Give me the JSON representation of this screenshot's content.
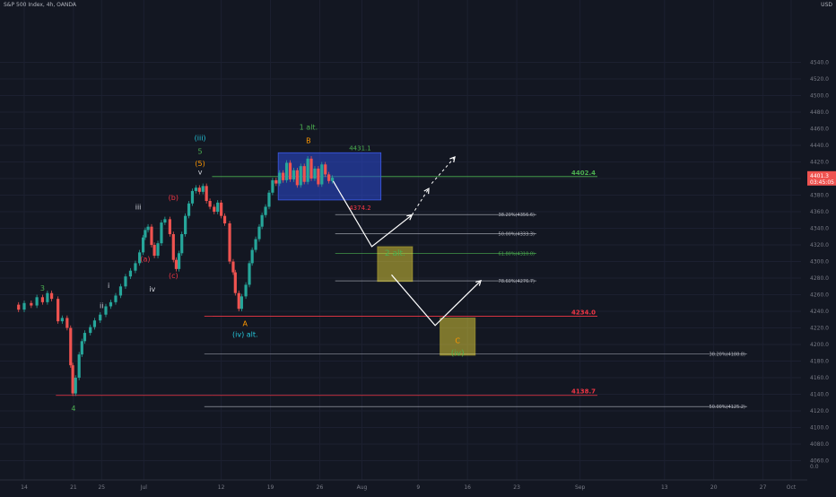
{
  "header": {
    "title": "S&P 500 Index, 4h, OANDA",
    "unit": "USD"
  },
  "chart_data": {
    "type": "candlestick",
    "title": "S&P 500 Index, 4h, OANDA",
    "ylim": [
      4053,
      4558
    ],
    "y_ticks": [
      4060.0,
      4080.0,
      4100.0,
      4120.0,
      4140.0,
      4160.0,
      4180.0,
      4200.0,
      4220.0,
      4240.0,
      4260.0,
      4280.0,
      4300.0,
      4320.0,
      4340.0,
      4360.0,
      4380.0,
      4400.0,
      4420.0,
      4440.0,
      4460.0,
      4480.0,
      4500.0,
      4520.0,
      4540.0
    ],
    "y_zero_label": "0.0",
    "x_ticks": [
      {
        "label": "14",
        "day": 0
      },
      {
        "label": "21",
        "day": 7
      },
      {
        "label": "25",
        "day": 11
      },
      {
        "label": "Jul",
        "day": 17
      },
      {
        "label": "12",
        "day": 28
      },
      {
        "label": "19",
        "day": 35
      },
      {
        "label": "26",
        "day": 42
      },
      {
        "label": "Aug",
        "day": 48
      },
      {
        "label": "9",
        "day": 56
      },
      {
        "label": "16",
        "day": 63
      },
      {
        "label": "23",
        "day": 70
      },
      {
        "label": "Sep",
        "day": 79
      },
      {
        "label": "13",
        "day": 91
      },
      {
        "label": "20",
        "day": 98
      },
      {
        "label": "27",
        "day": 105
      },
      {
        "label": "Oct",
        "day": 109
      }
    ],
    "price_path": [
      {
        "day": -1.6,
        "price": 4248
      },
      {
        "day": -0.8,
        "price": 4242
      },
      {
        "day": 0,
        "price": 4250
      },
      {
        "day": 1,
        "price": 4247
      },
      {
        "day": 1.8,
        "price": 4257
      },
      {
        "day": 2.6,
        "price": 4251
      },
      {
        "day": 3.3,
        "price": 4262
      },
      {
        "day": 3.9,
        "price": 4255
      },
      {
        "day": 4.8,
        "price": 4228
      },
      {
        "day": 5.4,
        "price": 4232
      },
      {
        "day": 6.1,
        "price": 4220
      },
      {
        "day": 6.6,
        "price": 4175
      },
      {
        "day": 6.9,
        "price": 4141
      },
      {
        "day": 7.3,
        "price": 4160
      },
      {
        "day": 7.8,
        "price": 4188
      },
      {
        "day": 8.2,
        "price": 4204
      },
      {
        "day": 8.6,
        "price": 4214
      },
      {
        "day": 9.4,
        "price": 4221
      },
      {
        "day": 10,
        "price": 4229
      },
      {
        "day": 10.8,
        "price": 4236
      },
      {
        "day": 11.6,
        "price": 4246
      },
      {
        "day": 12.3,
        "price": 4251
      },
      {
        "day": 13,
        "price": 4259
      },
      {
        "day": 13.7,
        "price": 4270
      },
      {
        "day": 14.4,
        "price": 4282
      },
      {
        "day": 15.1,
        "price": 4289
      },
      {
        "day": 15.8,
        "price": 4298
      },
      {
        "day": 16.4,
        "price": 4311
      },
      {
        "day": 16.9,
        "price": 4329
      },
      {
        "day": 17.2,
        "price": 4338
      },
      {
        "day": 17.6,
        "price": 4342
      },
      {
        "day": 18.1,
        "price": 4320
      },
      {
        "day": 18.5,
        "price": 4307
      },
      {
        "day": 19,
        "price": 4322
      },
      {
        "day": 19.5,
        "price": 4347
      },
      {
        "day": 20,
        "price": 4351
      },
      {
        "day": 20.7,
        "price": 4333
      },
      {
        "day": 21.2,
        "price": 4302
      },
      {
        "day": 21.6,
        "price": 4291
      },
      {
        "day": 22,
        "price": 4310
      },
      {
        "day": 22.4,
        "price": 4333
      },
      {
        "day": 22.9,
        "price": 4355
      },
      {
        "day": 23.4,
        "price": 4370
      },
      {
        "day": 23.9,
        "price": 4385
      },
      {
        "day": 24.4,
        "price": 4389
      },
      {
        "day": 24.9,
        "price": 4384
      },
      {
        "day": 25.4,
        "price": 4391
      },
      {
        "day": 25.9,
        "price": 4373
      },
      {
        "day": 26.4,
        "price": 4366
      },
      {
        "day": 27,
        "price": 4360
      },
      {
        "day": 27.5,
        "price": 4371
      },
      {
        "day": 28,
        "price": 4355
      },
      {
        "day": 28.5,
        "price": 4346
      },
      {
        "day": 29.2,
        "price": 4300
      },
      {
        "day": 29.7,
        "price": 4287
      },
      {
        "day": 30,
        "price": 4262
      },
      {
        "day": 30.5,
        "price": 4243
      },
      {
        "day": 30.9,
        "price": 4258
      },
      {
        "day": 31.5,
        "price": 4272
      },
      {
        "day": 32,
        "price": 4298
      },
      {
        "day": 32.4,
        "price": 4314
      },
      {
        "day": 32.9,
        "price": 4327
      },
      {
        "day": 33.4,
        "price": 4342
      },
      {
        "day": 33.8,
        "price": 4356
      },
      {
        "day": 34.3,
        "price": 4366
      },
      {
        "day": 34.8,
        "price": 4383
      },
      {
        "day": 35.3,
        "price": 4398
      },
      {
        "day": 35.8,
        "price": 4394
      },
      {
        "day": 36.3,
        "price": 4407
      },
      {
        "day": 36.8,
        "price": 4398
      },
      {
        "day": 37.3,
        "price": 4419
      },
      {
        "day": 37.8,
        "price": 4399
      },
      {
        "day": 38.3,
        "price": 4410
      },
      {
        "day": 38.8,
        "price": 4392
      },
      {
        "day": 39.3,
        "price": 4415
      },
      {
        "day": 39.8,
        "price": 4396
      },
      {
        "day": 40.3,
        "price": 4424
      },
      {
        "day": 40.8,
        "price": 4400
      },
      {
        "day": 41.3,
        "price": 4412
      },
      {
        "day": 41.8,
        "price": 4393
      },
      {
        "day": 42.3,
        "price": 4417
      },
      {
        "day": 42.8,
        "price": 4405
      },
      {
        "day": 43.3,
        "price": 4397
      },
      {
        "day": 43.8,
        "price": 4401
      }
    ],
    "horizontal_lines": [
      {
        "price": 4402.4,
        "label": "4402.4",
        "color": "#4caf50"
      },
      {
        "price": 4234.0,
        "label": "4234.0",
        "color": "#f23645"
      },
      {
        "price": 4138.7,
        "label": "4138.7",
        "color": "#f23645"
      }
    ],
    "current_price": {
      "value": "4401.3",
      "countdown": "03:45:05"
    },
    "box": {
      "top": 4431.1,
      "bottom": 4374.2,
      "top_label": "4431.1",
      "bottom_label": "4374.2"
    },
    "fib_levels": [
      {
        "price": 4356.6,
        "label": "38.20%(4356.6)",
        "color": "#b2b5be"
      },
      {
        "price": 4333.3,
        "label": "50.00%(4333.3)",
        "color": "#b2b5be"
      },
      {
        "price": 4310.0,
        "label": "61.80%(4310.0)",
        "color": "#4caf50"
      },
      {
        "price": 4276.7,
        "label": "78.60%(4276.7)",
        "color": "#b2b5be"
      },
      {
        "price": 4188.8,
        "label": "38.20%(4188.8)",
        "color": "#b2b5be"
      },
      {
        "price": 4125.2,
        "label": "50.00%(4125.2)",
        "color": "#b2b5be"
      }
    ],
    "zones": [
      {
        "top": 4318,
        "bottom": 4276,
        "label": "2 alt.",
        "color": "#ffeb3b"
      },
      {
        "top": 4232,
        "bottom": 4187,
        "label": "(iv)",
        "color": "#ffeb3b",
        "sub_label": "C"
      }
    ],
    "wave_labels": [
      {
        "text": "3",
        "day": 2.6,
        "price": 4265,
        "color": "#4caf50"
      },
      {
        "text": "4",
        "day": 7,
        "price": 4120,
        "color": "#4caf50"
      },
      {
        "text": "i",
        "day": 12,
        "price": 4268,
        "color": "#d1d4dc"
      },
      {
        "text": "ii",
        "day": 11,
        "price": 4244,
        "color": "#d1d4dc"
      },
      {
        "text": "iii",
        "day": 16.2,
        "price": 4363,
        "color": "#d1d4dc"
      },
      {
        "text": "iv",
        "day": 18.2,
        "price": 4264,
        "color": "#d1d4dc"
      },
      {
        "text": "v",
        "day": 25,
        "price": 4405,
        "color": "#d1d4dc"
      },
      {
        "text": "(a)",
        "day": 17.2,
        "price": 4300,
        "color": "#f23645"
      },
      {
        "text": "(b)",
        "day": 21.2,
        "price": 4374,
        "color": "#f23645"
      },
      {
        "text": "(c)",
        "day": 21.2,
        "price": 4280,
        "color": "#f23645"
      },
      {
        "text": "(5)",
        "day": 25,
        "price": 4415,
        "color": "#ff9800"
      },
      {
        "text": "5",
        "day": 25,
        "price": 4430,
        "color": "#4caf50"
      },
      {
        "text": "(iii)",
        "day": 25,
        "price": 4446,
        "color": "#26c6da"
      },
      {
        "text": "A",
        "day": 31.4,
        "price": 4222,
        "color": "#ff9800"
      },
      {
        "text": "(iv) alt.",
        "day": 31.4,
        "price": 4209,
        "color": "#26c6da"
      },
      {
        "text": "1 alt.",
        "day": 40.4,
        "price": 4459,
        "color": "#4caf50"
      },
      {
        "text": "B",
        "day": 40.4,
        "price": 4443,
        "color": "#ff9800"
      }
    ],
    "projection_solid": [
      {
        "day": 43.9,
        "price": 4397
      },
      {
        "day": 49.4,
        "price": 4318
      },
      {
        "day": 55.1,
        "price": 4356
      }
    ],
    "projection_solid_2": [
      {
        "day": 52.2,
        "price": 4284
      },
      {
        "day": 58.4,
        "price": 4223
      },
      {
        "day": 64.9,
        "price": 4277
      }
    ],
    "projection_dashed": [
      {
        "day": 55.1,
        "price": 4356
      },
      {
        "day": 57.5,
        "price": 4388
      }
    ],
    "projection_dashed_2": [
      {
        "day": 57.9,
        "price": 4394
      },
      {
        "day": 61.2,
        "price": 4426
      }
    ]
  }
}
